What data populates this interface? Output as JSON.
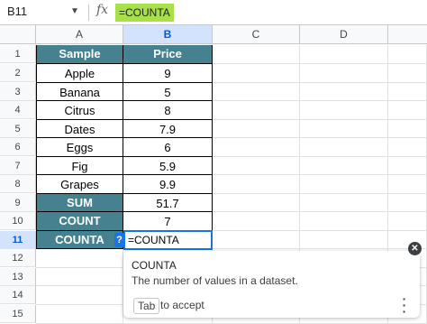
{
  "formula_bar": {
    "name_box": "B11",
    "fx_icon": "fx",
    "formula": "=COUNTA"
  },
  "columns": [
    "A",
    "B",
    "C",
    "D"
  ],
  "row_numbers": [
    "1",
    "2",
    "3",
    "4",
    "5",
    "6",
    "7",
    "8",
    "9",
    "10",
    "11",
    "12",
    "13",
    "14",
    "15"
  ],
  "table": {
    "header": [
      "Sample",
      "Price"
    ],
    "rows": [
      [
        "Apple",
        "9"
      ],
      [
        "Banana",
        "5"
      ],
      [
        "Citrus",
        "8"
      ],
      [
        "Dates",
        "7.9"
      ],
      [
        "Eggs",
        "6"
      ],
      [
        "Fig",
        "5.9"
      ],
      [
        "Grapes",
        "9.9"
      ]
    ],
    "summary": [
      [
        "SUM",
        "51.7"
      ],
      [
        "COUNT",
        "7"
      ],
      [
        "COUNTA",
        ""
      ]
    ]
  },
  "active_cell": {
    "value": "=COUNTA",
    "help_label": "?"
  },
  "tooltip": {
    "title": "COUNTA",
    "description": "The number of values in a dataset.",
    "key": "Tab",
    "accept_text": "to accept",
    "close_icon": "close-icon",
    "more_icon": "more-vert-icon"
  },
  "colors": {
    "header_fill": "#45818e",
    "formula_highlight": "#a8e04a",
    "selection_blue": "#1a73e8"
  }
}
